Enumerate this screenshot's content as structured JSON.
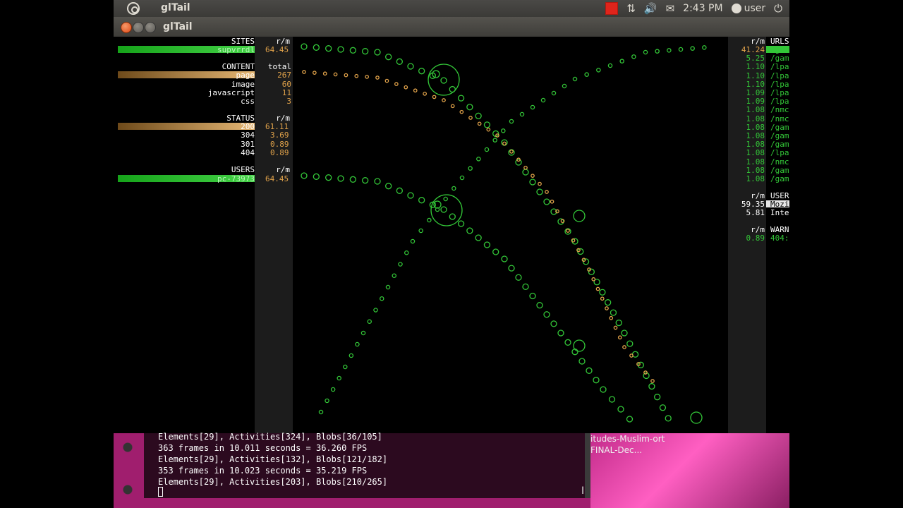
{
  "top_panel": {
    "app_name": "glTail",
    "clock": "2:43 PM",
    "user": "user"
  },
  "window": {
    "title": "glTail"
  },
  "left": {
    "sites": {
      "header": "SITES",
      "rm_header": "r/m",
      "items": [
        {
          "label": "supvrrdl",
          "value": "64.45",
          "bar": 0.9
        }
      ]
    },
    "content": {
      "header": "CONTENT",
      "rm_header": "total",
      "items": [
        {
          "label": "page",
          "value": "267"
        },
        {
          "label": "image",
          "value": "60"
        },
        {
          "label": "javascript",
          "value": "11"
        },
        {
          "label": "css",
          "value": "3"
        }
      ]
    },
    "status": {
      "header": "STATUS",
      "rm_header": "r/m",
      "items": [
        {
          "label": "200",
          "value": "61.11"
        },
        {
          "label": "304",
          "value": "3.69"
        },
        {
          "label": "301",
          "value": "0.89"
        },
        {
          "label": "404",
          "value": "0.89"
        }
      ]
    },
    "users": {
      "header": "USERS",
      "rm_header": "r/m",
      "items": [
        {
          "label": "pc-73973",
          "value": "64.45"
        }
      ]
    }
  },
  "right": {
    "urls": {
      "rm_header": "r/m",
      "header": "URLS",
      "items": [
        {
          "value": "41.24",
          "label": "/gam"
        },
        {
          "value": "5.25",
          "label": "/gam"
        },
        {
          "value": "1.10",
          "label": "/lpa"
        },
        {
          "value": "1.10",
          "label": "/lpa"
        },
        {
          "value": "1.10",
          "label": "/lpa"
        },
        {
          "value": "1.09",
          "label": "/lpa"
        },
        {
          "value": "1.09",
          "label": "/lpa"
        },
        {
          "value": "1.08",
          "label": "/nmc"
        },
        {
          "value": "1.08",
          "label": "/nmc"
        },
        {
          "value": "1.08",
          "label": "/gam"
        },
        {
          "value": "1.08",
          "label": "/gam"
        },
        {
          "value": "1.08",
          "label": "/gam"
        },
        {
          "value": "1.08",
          "label": "/lpa"
        },
        {
          "value": "1.08",
          "label": "/nmc"
        },
        {
          "value": "1.08",
          "label": "/gam"
        },
        {
          "value": "1.08",
          "label": "/gam"
        }
      ]
    },
    "user_agents": {
      "rm_header": "r/m",
      "header": "USER",
      "items": [
        {
          "value": "59.35",
          "label": "Mozi"
        },
        {
          "value": "5.81",
          "label": "Inte"
        }
      ]
    },
    "warnings": {
      "rm_header": "r/m",
      "header": "WARN",
      "items": [
        {
          "value": "0.89",
          "label": "404:"
        }
      ]
    }
  },
  "terminal": {
    "lines": [
      "Elements[29], Activities[324], Blobs[36/105]",
      "363 frames in 10.011 seconds = 36.260 FPS",
      "Elements[29], Activities[132], Blobs[121/182]",
      "353 frames in 10.023 seconds = 35.219 FPS",
      "Elements[29], Activities[203], Blobs[210/265]"
    ]
  },
  "background_window": {
    "filename": "itudes-Muslim-ort FINAL-Dec..."
  },
  "colors": {
    "green": "#33c738",
    "amber": "#e0a24a",
    "panel": "#3c3b37"
  }
}
